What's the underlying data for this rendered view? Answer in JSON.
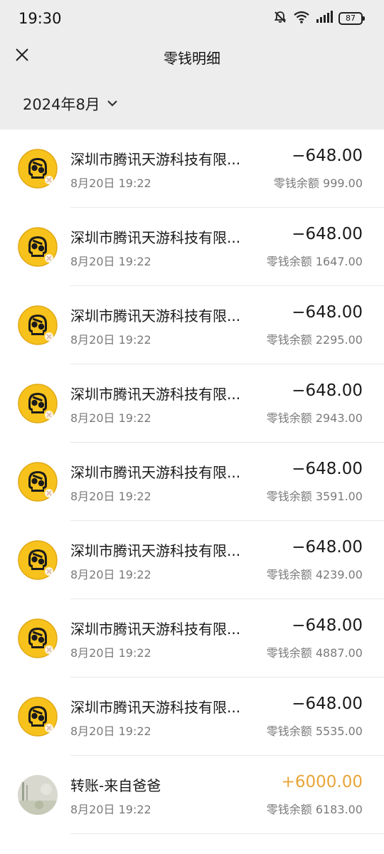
{
  "status": {
    "time": "19:30",
    "battery": "87"
  },
  "header": {
    "title": "零钱明细"
  },
  "filter": {
    "month": "2024年8月"
  },
  "icons": {
    "close": "close-icon",
    "chevron": "chevron-down-icon",
    "merchant": "skull-game-logo-icon",
    "contact": "contact-avatar-icon"
  },
  "colors": {
    "background": "#ededed",
    "income": "#e9a53a",
    "logo_yellow": "#f7c21c"
  },
  "transactions": [
    {
      "title": "深圳市腾讯天游科技有限...",
      "time": "8月20日 19:22",
      "amount": "−648.00",
      "balance": "零钱余额 999.00",
      "kind": "merchant"
    },
    {
      "title": "深圳市腾讯天游科技有限...",
      "time": "8月20日 19:22",
      "amount": "−648.00",
      "balance": "零钱余额 1647.00",
      "kind": "merchant"
    },
    {
      "title": "深圳市腾讯天游科技有限...",
      "time": "8月20日 19:22",
      "amount": "−648.00",
      "balance": "零钱余额 2295.00",
      "kind": "merchant"
    },
    {
      "title": "深圳市腾讯天游科技有限...",
      "time": "8月20日 19:22",
      "amount": "−648.00",
      "balance": "零钱余额 2943.00",
      "kind": "merchant"
    },
    {
      "title": "深圳市腾讯天游科技有限...",
      "time": "8月20日 19:22",
      "amount": "−648.00",
      "balance": "零钱余额 3591.00",
      "kind": "merchant"
    },
    {
      "title": "深圳市腾讯天游科技有限...",
      "time": "8月20日 19:22",
      "amount": "−648.00",
      "balance": "零钱余额 4239.00",
      "kind": "merchant"
    },
    {
      "title": "深圳市腾讯天游科技有限...",
      "time": "8月20日 19:22",
      "amount": "−648.00",
      "balance": "零钱余额 4887.00",
      "kind": "merchant"
    },
    {
      "title": "深圳市腾讯天游科技有限...",
      "time": "8月20日 19:22",
      "amount": "−648.00",
      "balance": "零钱余额 5535.00",
      "kind": "merchant"
    },
    {
      "title": "转账-来自爸爸",
      "time": "8月20日 19:22",
      "amount": "+6000.00",
      "balance": "零钱余额 6183.00",
      "kind": "transfer"
    }
  ]
}
